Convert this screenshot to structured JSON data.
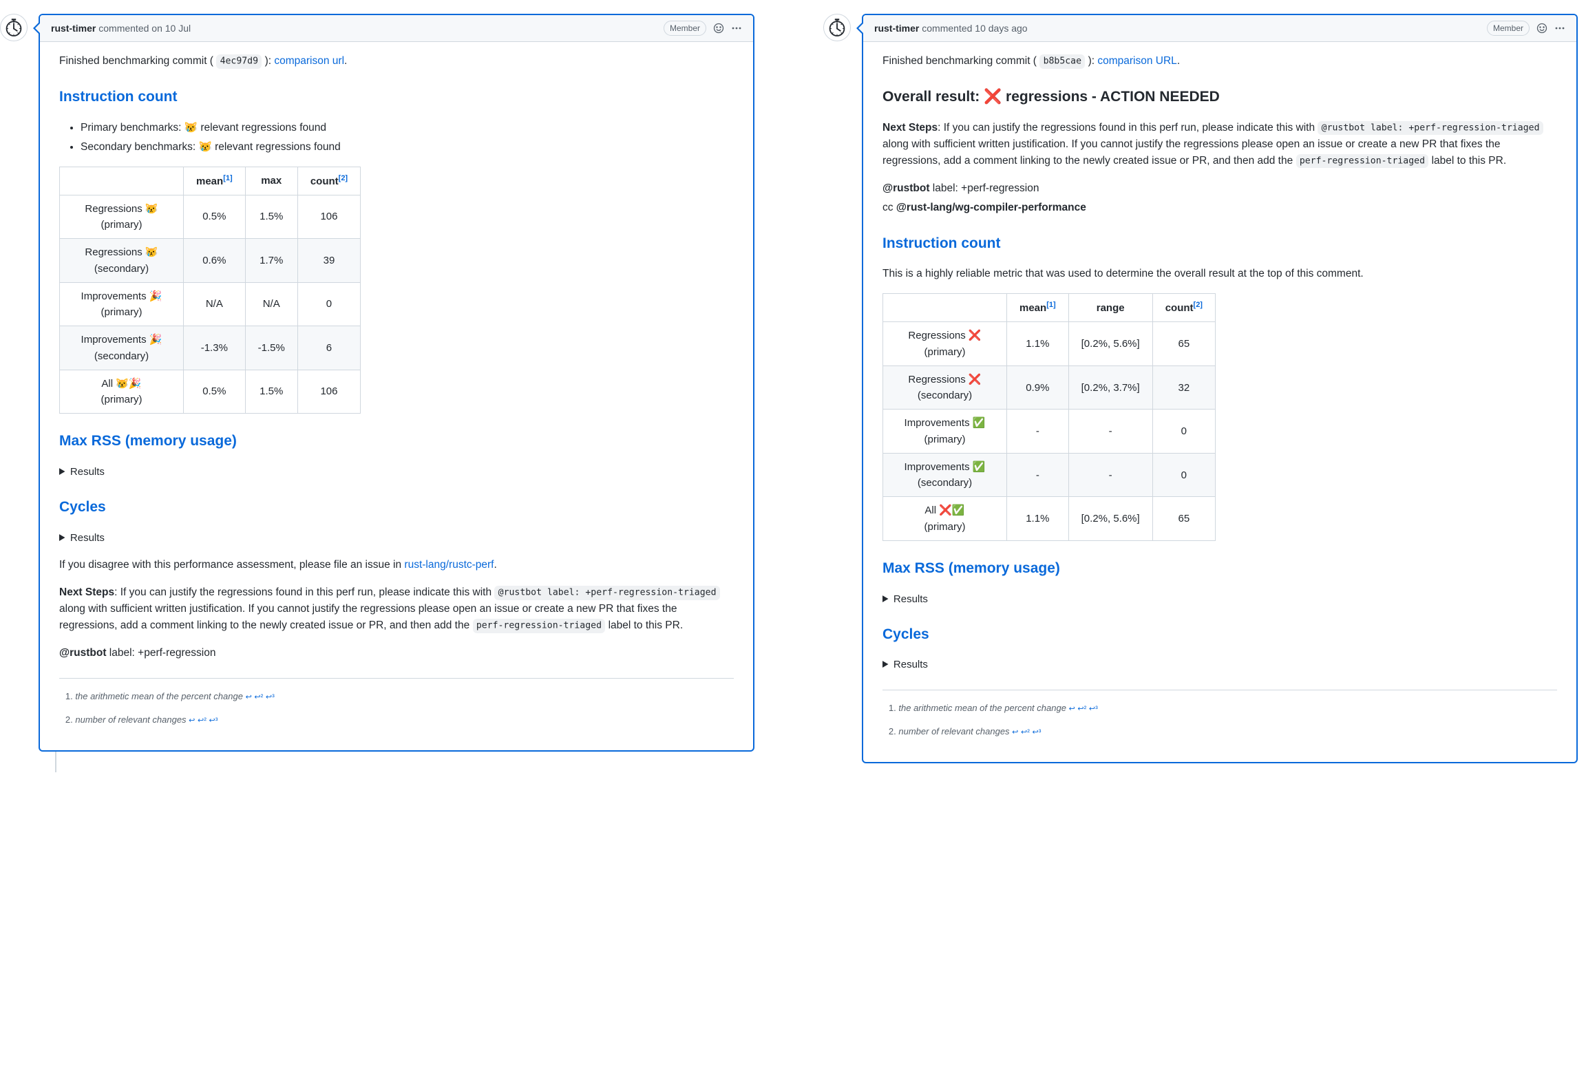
{
  "left": {
    "author": "rust-timer",
    "timestamp": "commented on 10 Jul",
    "badge": "Member",
    "intro_prefix": "Finished benchmarking commit (",
    "commit": "4ec97d9",
    "intro_mid": "): ",
    "comparison_link": "comparison url",
    "intro_suffix": ".",
    "instruction_count_title": "Instruction count",
    "bullets": [
      {
        "label": "Primary benchmarks:",
        "emoji": "😿",
        "rest": "relevant regressions found"
      },
      {
        "label": "Secondary benchmarks:",
        "emoji": "😿",
        "rest": "relevant regressions found"
      }
    ],
    "table_headers": [
      "",
      "mean",
      "max",
      "count"
    ],
    "table_super": {
      "mean": "[1]",
      "count": "[2]"
    },
    "table_rows": [
      {
        "label": "Regressions 😿 (primary)",
        "mean": "0.5%",
        "max": "1.5%",
        "count": "106"
      },
      {
        "label": "Regressions 😿 (secondary)",
        "mean": "0.6%",
        "max": "1.7%",
        "count": "39"
      },
      {
        "label": "Improvements 🎉 (primary)",
        "mean": "N/A",
        "max": "N/A",
        "count": "0"
      },
      {
        "label": "Improvements 🎉 (secondary)",
        "mean": "-1.3%",
        "max": "-1.5%",
        "count": "6"
      },
      {
        "label": "All 😿🎉 (primary)",
        "mean": "0.5%",
        "max": "1.5%",
        "count": "106"
      }
    ],
    "max_rss_title": "Max RSS (memory usage)",
    "results_label": "Results",
    "cycles_title": "Cycles",
    "disagree_prefix": "If you disagree with this performance assessment, please file an issue in ",
    "disagree_link": "rust-lang/rustc-perf",
    "next_steps_label": "Next Steps",
    "next_steps_1": ": If you can justify the regressions found in this perf run, please indicate this with ",
    "next_steps_code1": "@rustbot label: +perf-regression-triaged",
    "next_steps_2": " along with sufficient written justification. If you cannot justify the regressions please open an issue or create a new PR that fixes the regressions, add a comment linking to the newly created issue or PR, and then add the ",
    "next_steps_code2": "perf-regression-triaged",
    "next_steps_3": " label to this PR.",
    "rustbot_line": " label: +perf-regression",
    "rustbot_label": "@rustbot",
    "footnotes": [
      {
        "text": "the arithmetic mean of the percent change",
        "back": [
          "↩",
          "↩²",
          "↩³"
        ]
      },
      {
        "text": "number of relevant changes",
        "back": [
          "↩",
          "↩²",
          "↩³"
        ]
      }
    ]
  },
  "right": {
    "author": "rust-timer",
    "timestamp": "commented 10 days ago",
    "badge": "Member",
    "intro_prefix": "Finished benchmarking commit (",
    "commit": "b8b5cae",
    "intro_mid": "): ",
    "comparison_link": "comparison URL",
    "intro_suffix": ".",
    "overall_title": "Overall result: ❌ regressions - ACTION NEEDED",
    "next_steps_label": "Next Steps",
    "next_steps_1": ": If you can justify the regressions found in this perf run, please indicate this with ",
    "next_steps_code1": "@rustbot label: +perf-regression-triaged",
    "next_steps_2": " along with sufficient written justification. If you cannot justify the regressions please open an issue or create a new PR that fixes the regressions, add a comment linking to the newly created issue or PR, and then add the ",
    "next_steps_code2": "perf-regression-triaged",
    "next_steps_3": " label to this PR.",
    "rustbot_label": "@rustbot",
    "rustbot_line": " label: +perf-regression",
    "cc_line_prefix": "cc ",
    "cc_mention": "@rust-lang/wg-compiler-performance",
    "instruction_count_title": "Instruction count",
    "metric_desc": "This is a highly reliable metric that was used to determine the overall result at the top of this comment.",
    "table_headers": [
      "",
      "mean",
      "range",
      "count"
    ],
    "table_super": {
      "mean": "[1]",
      "count": "[2]"
    },
    "table_rows": [
      {
        "label": "Regressions ❌ (primary)",
        "mean": "1.1%",
        "range": "[0.2%, 5.6%]",
        "count": "65"
      },
      {
        "label": "Regressions ❌ (secondary)",
        "mean": "0.9%",
        "range": "[0.2%, 3.7%]",
        "count": "32"
      },
      {
        "label": "Improvements ✅ (primary)",
        "mean": "-",
        "range": "-",
        "count": "0"
      },
      {
        "label": "Improvements ✅ (secondary)",
        "mean": "-",
        "range": "-",
        "count": "0"
      },
      {
        "label": "All ❌✅ (primary)",
        "mean": "1.1%",
        "range": "[0.2%, 5.6%]",
        "count": "65"
      }
    ],
    "max_rss_title": "Max RSS (memory usage)",
    "results_label": "Results",
    "cycles_title": "Cycles",
    "footnotes": [
      {
        "text": "the arithmetic mean of the percent change",
        "back": [
          "↩",
          "↩²",
          "↩³"
        ]
      },
      {
        "text": "number of relevant changes",
        "back": [
          "↩",
          "↩²",
          "↩³"
        ]
      }
    ]
  }
}
